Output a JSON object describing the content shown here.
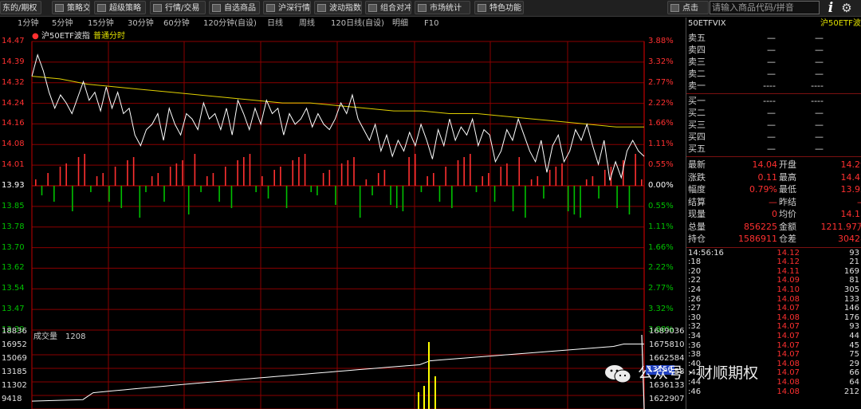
{
  "toolbar": {
    "items": [
      "东的/期权",
      "策略交易",
      "超级策略",
      "行情/交易",
      "自选商品",
      "沪深行情",
      "波动指数",
      "组合对冲",
      "市场统计",
      "特色功能"
    ],
    "search_button": "点击",
    "search_placeholder": "请输入商品代码/拼音"
  },
  "tabs": [
    "1分钟",
    "5分钟",
    "15分钟",
    "30分钟",
    "60分钟",
    "120分钟(自设)",
    "日线",
    "周线",
    "120日线(自设)",
    "明细",
    "F10"
  ],
  "chart_header": {
    "symbol": "沪50ETF波指",
    "mode": "普通分时"
  },
  "price_axis": {
    "left_ticks": [
      "14.47",
      "14.39",
      "14.32",
      "14.24",
      "14.16",
      "14.08",
      "14.01",
      "13.93",
      "13.85",
      "13.78",
      "13.70",
      "13.62",
      "13.54",
      "13.47",
      "13.39"
    ],
    "right_ticks": [
      "3.88%",
      "3.32%",
      "2.77%",
      "2.22%",
      "1.66%",
      "1.11%",
      "0.55%",
      "0.00%",
      "0.55%",
      "1.11%",
      "1.66%",
      "2.22%",
      "2.77%",
      "3.32%",
      "3.88%"
    ]
  },
  "volume_panel": {
    "label": "成交量",
    "value": "1208",
    "left_ticks": [
      "18836",
      "16952",
      "15069",
      "13185",
      "11302",
      "9418"
    ],
    "right_ticks": [
      "1689036",
      "1675810",
      "1662584",
      "1649358",
      "1636133",
      "1622907"
    ],
    "highlight_tick": "13156"
  },
  "chart_data": {
    "type": "line",
    "price_range": [
      13.39,
      14.47
    ],
    "base_price": 13.93,
    "price": [
      14.34,
      14.42,
      14.36,
      14.28,
      14.22,
      14.27,
      14.24,
      14.2,
      14.26,
      14.32,
      14.25,
      14.28,
      14.21,
      14.3,
      14.22,
      14.28,
      14.2,
      14.22,
      14.12,
      14.08,
      14.14,
      14.16,
      14.2,
      14.1,
      14.22,
      14.16,
      14.12,
      14.2,
      14.18,
      14.14,
      14.24,
      14.18,
      14.2,
      14.14,
      14.22,
      14.12,
      14.25,
      14.2,
      14.14,
      14.22,
      14.16,
      14.25,
      14.2,
      14.22,
      14.12,
      14.2,
      14.16,
      14.18,
      14.22,
      14.15,
      14.2,
      14.16,
      14.14,
      14.18,
      14.24,
      14.2,
      14.27,
      14.18,
      14.14,
      14.1,
      14.16,
      14.06,
      14.12,
      14.04,
      14.1,
      14.06,
      14.13,
      14.08,
      14.16,
      14.1,
      14.03,
      14.14,
      14.08,
      14.18,
      14.1,
      14.15,
      14.12,
      14.18,
      14.08,
      14.14,
      14.12,
      14.02,
      14.06,
      14.14,
      14.1,
      14.18,
      14.12,
      14.06,
      14.02,
      14.1,
      13.98,
      14.08,
      14.12,
      14.02,
      14.06,
      14.14,
      14.1,
      14.16,
      14.08,
      14.01,
      14.1,
      13.95,
      14.02,
      13.96,
      14.06,
      14.1,
      14.06,
      14.04
    ],
    "avg": [
      14.34,
      14.33,
      14.31,
      14.3,
      14.29,
      14.28,
      14.27,
      14.26,
      14.25,
      14.24,
      14.24,
      14.23,
      14.22,
      14.21,
      14.21,
      14.2,
      14.2,
      14.19,
      14.18,
      14.17,
      14.16,
      14.15,
      14.15
    ],
    "volume_bars": [
      1,
      -1,
      1,
      -1,
      1,
      1,
      -1,
      1,
      1,
      -1,
      1,
      1,
      -1,
      1,
      -1,
      1,
      1,
      -1,
      -1,
      1,
      1,
      -1,
      1,
      1,
      1,
      -1,
      1,
      -1,
      1,
      1,
      -1,
      1,
      -1,
      1,
      1,
      1,
      -1,
      1,
      -1,
      1,
      1,
      -1,
      1,
      1,
      1,
      -1,
      -1,
      1,
      1,
      -1,
      1,
      1,
      1,
      -1,
      1,
      -1,
      1,
      1,
      -1,
      -1,
      -1,
      1,
      1,
      -1,
      1,
      1,
      -1,
      1,
      -1,
      1,
      1,
      1,
      -1,
      1,
      1,
      -1,
      1,
      1,
      -1,
      1,
      -1,
      1,
      1,
      -1,
      1,
      1,
      1,
      -1,
      -1,
      -1,
      1,
      1,
      -1,
      1,
      1,
      -1,
      1,
      -1,
      1,
      1
    ],
    "cum_volume_range": [
      1622907,
      1689036
    ]
  },
  "quote": {
    "title_left": "50ETFVIX",
    "title_right": "沪50ETF波指",
    "asks": [
      {
        "k": "卖五",
        "p": "—",
        "v": "—"
      },
      {
        "k": "卖四",
        "p": "—",
        "v": "—"
      },
      {
        "k": "卖三",
        "p": "—",
        "v": "—"
      },
      {
        "k": "卖二",
        "p": "—",
        "v": "—"
      },
      {
        "k": "卖一",
        "p": "----",
        "v": "----"
      }
    ],
    "bids": [
      {
        "k": "买一",
        "p": "----",
        "v": "----"
      },
      {
        "k": "买二",
        "p": "—",
        "v": "—"
      },
      {
        "k": "买三",
        "p": "—",
        "v": "—"
      },
      {
        "k": "买四",
        "p": "—",
        "v": "—"
      },
      {
        "k": "买五",
        "p": "—",
        "v": "—"
      }
    ],
    "stats": [
      {
        "k1": "最新",
        "v1": "14.04",
        "k2": "开盘",
        "v2": "14.29"
      },
      {
        "k1": "涨跌",
        "v1": "0.11",
        "k2": "最高",
        "v2": "14.47"
      },
      {
        "k1": "幅度",
        "v1": "0.79%",
        "k2": "最低",
        "v2": "13.92"
      },
      {
        "k1": "结算",
        "v1": "—",
        "k2": "昨结",
        "v2": "—"
      },
      {
        "k1": "现量",
        "v1": "0",
        "k2": "均价",
        "v2": "14.15"
      },
      {
        "k1": "总量",
        "v1": "856225",
        "k2": "金额",
        "v2": "1211.97万"
      },
      {
        "k1": "持仓",
        "v1": "1586911",
        "k2": "仓差",
        "v2": "30428"
      }
    ]
  },
  "ticks": [
    {
      "t": "14:56:16",
      "p": "14.12",
      "v": "93"
    },
    {
      "t": ":18",
      "p": "14.12",
      "v": "21"
    },
    {
      "t": ":20",
      "p": "14.11",
      "v": "169"
    },
    {
      "t": ":22",
      "p": "14.09",
      "v": "81"
    },
    {
      "t": ":24",
      "p": "14.10",
      "v": "305"
    },
    {
      "t": ":26",
      "p": "14.08",
      "v": "133"
    },
    {
      "t": ":27",
      "p": "14.07",
      "v": "146"
    },
    {
      "t": ":30",
      "p": "14.08",
      "v": "176"
    },
    {
      "t": ":32",
      "p": "14.07",
      "v": "93"
    },
    {
      "t": ":34",
      "p": "14.07",
      "v": "44"
    },
    {
      "t": ":36",
      "p": "14.07",
      "v": "45"
    },
    {
      "t": ":38",
      "p": "14.07",
      "v": "75"
    },
    {
      "t": ":40",
      "p": "14.08",
      "v": "29"
    },
    {
      "t": ":42",
      "p": "14.07",
      "v": "66"
    },
    {
      "t": ":44",
      "p": "14.08",
      "v": "64"
    },
    {
      "t": ":46",
      "p": "14.08",
      "v": "212"
    }
  ],
  "watermark": "公众号 · 财顺期权",
  "colors": {
    "up": "#ff3030",
    "down": "#00c000",
    "price_line": "#ffffff",
    "avg_line": "#e0d000",
    "grid": "#8a0000",
    "highlight": "#ffff00"
  }
}
